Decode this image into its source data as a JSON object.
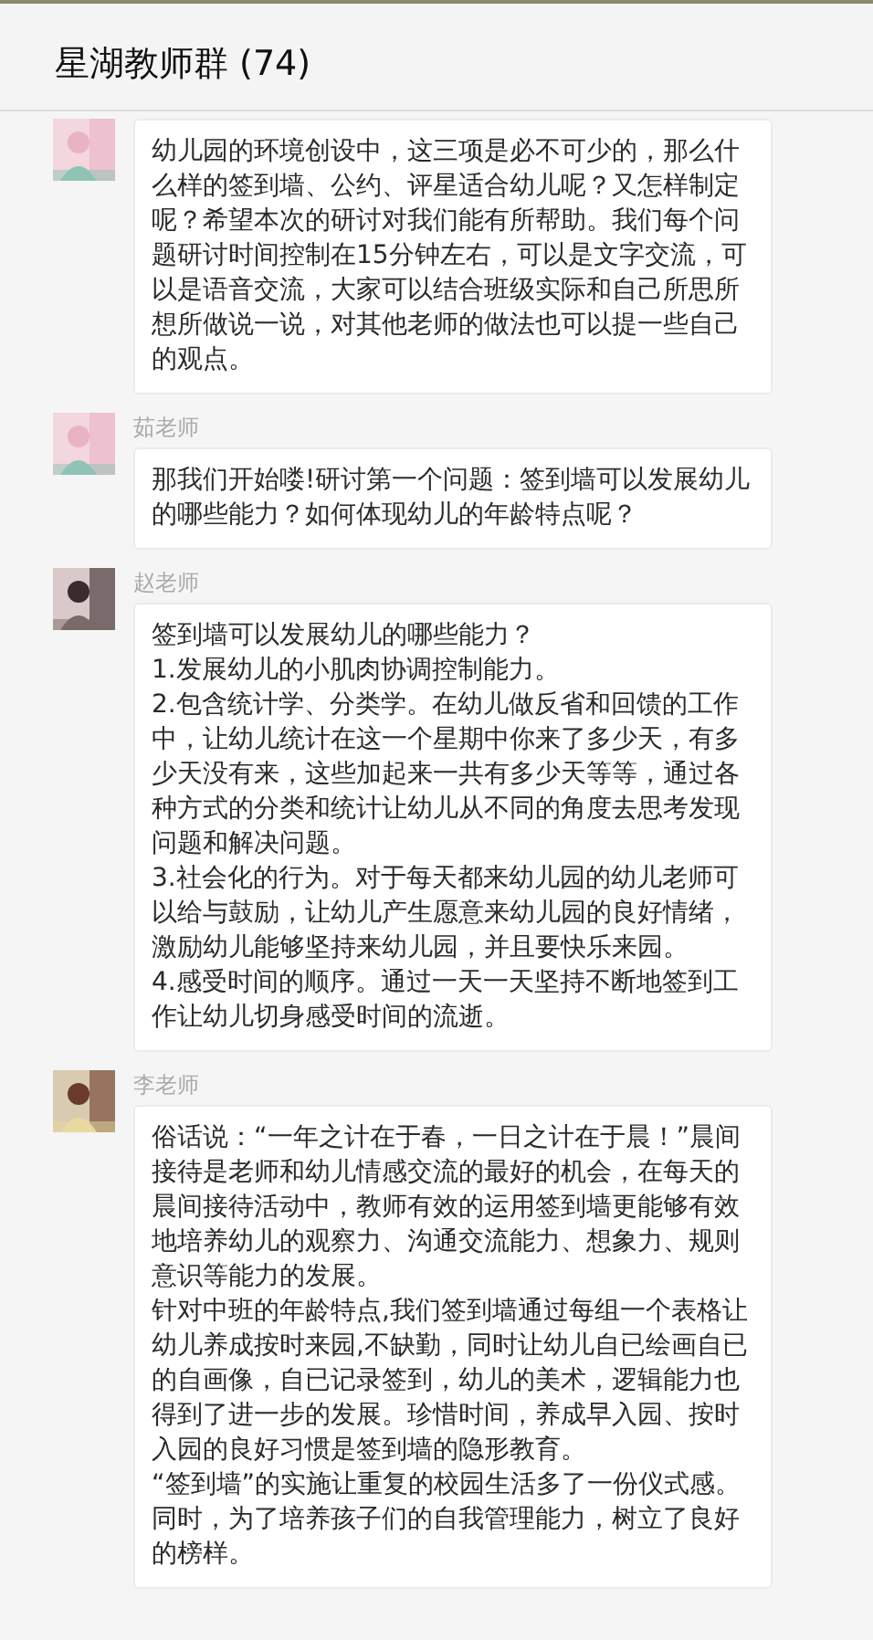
{
  "header": {
    "title": "星湖教师群 (74)"
  },
  "messages": [
    {
      "paragraphs": [
        "幼儿园的环境创设中，这三项是必不可少的，那么什么样的签到墙、公约、评星适合幼儿呢？又怎样制定呢？希望本次的研讨对我们能有所帮助。我们每个问题研讨时间控制在15分钟左右，可以是文字交流，可以是语音交流，大家可以结合班级实际和自己所思所想所做说一说，对其他老师的做法也可以提一些自己的观点。"
      ]
    },
    {
      "sender": "茹老师",
      "paragraphs": [
        "那我们开始喽!研讨第一个问题：签到墙可以发展幼儿的哪些能力？如何体现幼儿的年龄特点呢？"
      ]
    },
    {
      "sender": "赵老师",
      "paragraphs": [
        "签到墙可以发展幼儿的哪些能力？",
        "1.发展幼儿的小肌肉协调控制能力。",
        "2.包含统计学、分类学。在幼儿做反省和回馈的工作中，让幼儿统计在这一个星期中你来了多少天，有多少天没有来，这些加起来一共有多少天等等，通过各种方式的分类和统计让幼儿从不同的角度去思考发现问题和解决问题。",
        "3.社会化的行为。对于每天都来幼儿园的幼儿老师可以给与鼓励，让幼儿产生愿意来幼儿园的良好情绪，激励幼儿能够坚持来幼儿园，并且要快乐来园。",
        "4.感受时间的顺序。通过一天一天坚持不断地签到工作让幼儿切身感受时间的流逝。"
      ]
    },
    {
      "sender": "李老师",
      "paragraphs": [
        "俗话说：“一年之计在于春，一日之计在于晨！”晨间接待是老师和幼儿情感交流的最好的机会，在每天的晨间接待活动中，教师有效的运用签到墙更能够有效地培养幼儿的观察力、沟通交流能力、想象力、规则意识等能力的发展。",
        "针对中班的年龄特点,我们签到墙通过每组一个表格让幼儿养成按时来园,不缺勤，同时让幼儿自已绘画自已的自画像，自已记录签到，幼儿的美术，逻辑能力也得到了进一步的发展。珍惜时间，养成早入园、按时入园的良好习惯是签到墙的隐形教育。",
        "“签到墙”的实施让重复的校园生活多了一份仪式感。同时，为了培养孩子们的自我管理能力，树立了良好的榜样。"
      ]
    }
  ]
}
